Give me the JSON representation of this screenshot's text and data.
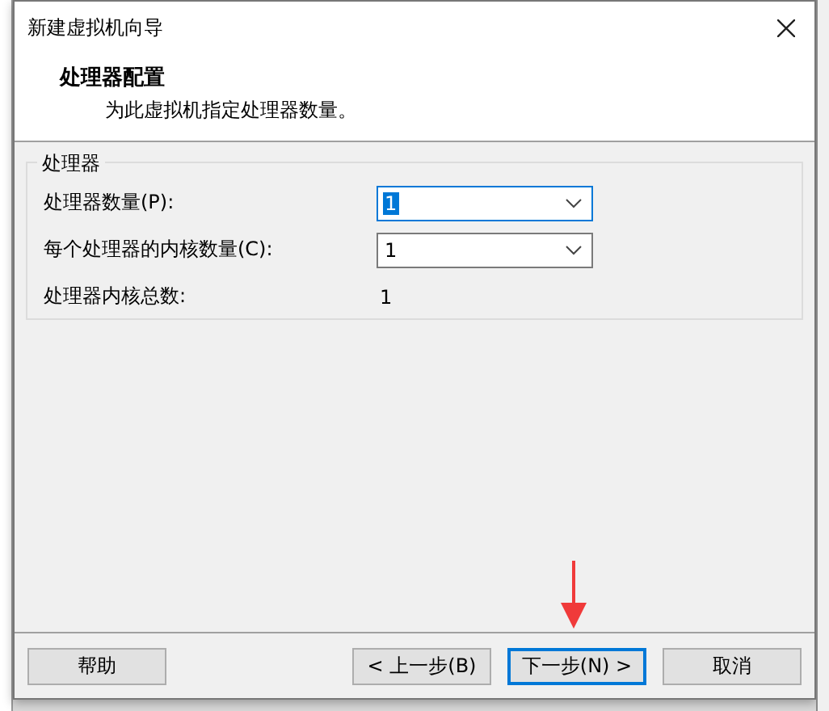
{
  "window": {
    "title": "新建虚拟机向导"
  },
  "header": {
    "title": "处理器配置",
    "subtitle": "为此虚拟机指定处理器数量。"
  },
  "group": {
    "title": "处理器",
    "rows": [
      {
        "kind": "combo",
        "label": "处理器数量(P):",
        "value": "1",
        "focused": true
      },
      {
        "kind": "combo",
        "label": "每个处理器的内核数量(C):",
        "value": "1",
        "focused": false
      },
      {
        "kind": "readout",
        "label": "处理器内核总数:",
        "value": "1"
      }
    ]
  },
  "buttons_left": [
    {
      "label": "帮助",
      "default": false
    }
  ],
  "buttons_right": [
    {
      "label": "< 上一步(B)",
      "default": false
    },
    {
      "label": "下一步(N) >",
      "default": true
    },
    {
      "label": "取消",
      "default": false
    }
  ]
}
